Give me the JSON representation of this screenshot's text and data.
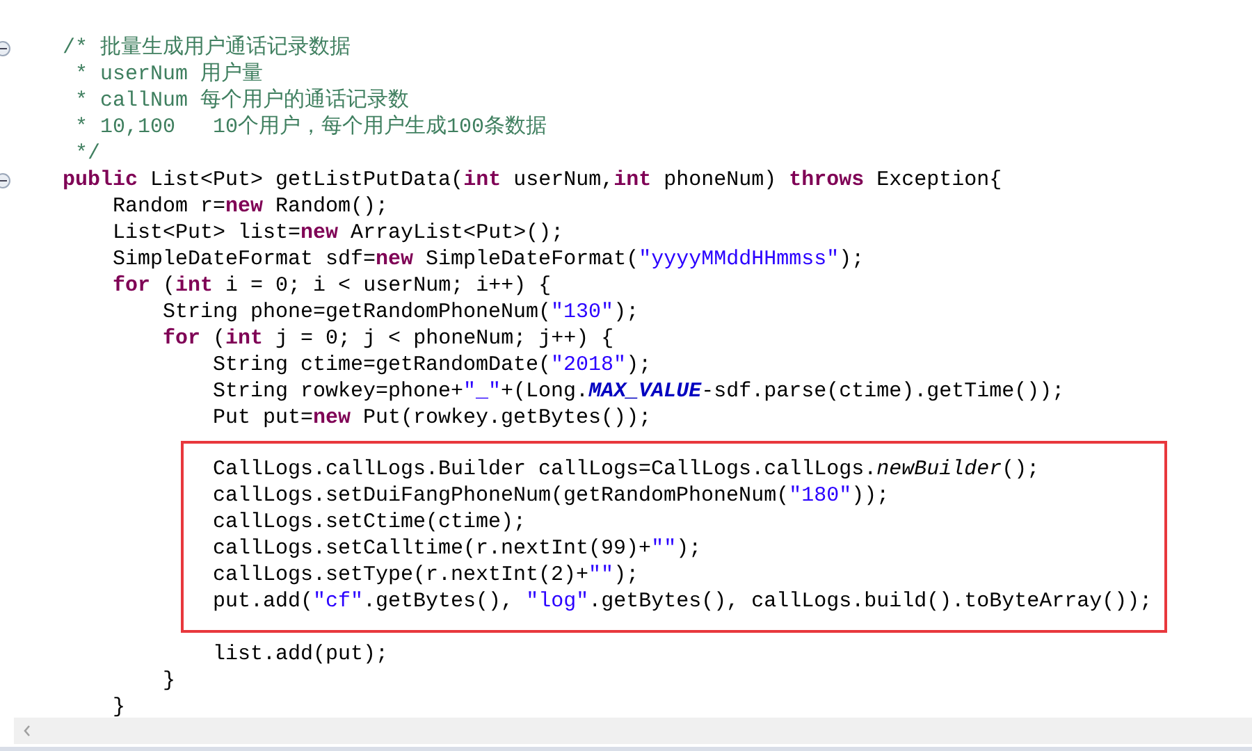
{
  "editor": {
    "lines": [
      {
        "expanded": true,
        "tokens": [
          {
            "kind": "comment",
            "text": "/* 批量生成用户通话记录数据"
          }
        ]
      },
      {
        "tokens": [
          {
            "kind": "comment",
            "text": " * userNum 用户量"
          }
        ]
      },
      {
        "tokens": [
          {
            "kind": "comment",
            "text": " * callNum 每个用户的通话记录数"
          }
        ]
      },
      {
        "tokens": [
          {
            "kind": "comment",
            "text": " * 10,100   10个用户，每个用户生成100条数据"
          }
        ]
      },
      {
        "tokens": [
          {
            "kind": "comment",
            "text": " */"
          }
        ]
      },
      {
        "expanded": true,
        "tokens": [
          {
            "kind": "keyword",
            "text": "public"
          },
          {
            "kind": "plain",
            "text": " List<Put> getListPutData("
          },
          {
            "kind": "keyword",
            "text": "int"
          },
          {
            "kind": "plain",
            "text": " userNum,"
          },
          {
            "kind": "keyword",
            "text": "int"
          },
          {
            "kind": "plain",
            "text": " phoneNum) "
          },
          {
            "kind": "keyword",
            "text": "throws"
          },
          {
            "kind": "plain",
            "text": " Exception{"
          }
        ],
        "children": [
          {
            "tokens": [
              {
                "kind": "plain",
                "text": "Random r="
              },
              {
                "kind": "keyword",
                "text": "new"
              },
              {
                "kind": "plain",
                "text": " Random();"
              }
            ]
          },
          {
            "tokens": [
              {
                "kind": "plain",
                "text": "List<Put> list="
              },
              {
                "kind": "keyword",
                "text": "new"
              },
              {
                "kind": "plain",
                "text": " ArrayList<Put>();"
              }
            ]
          },
          {
            "tokens": [
              {
                "kind": "plain",
                "text": "SimpleDateFormat sdf="
              },
              {
                "kind": "keyword",
                "text": "new"
              },
              {
                "kind": "plain",
                "text": " SimpleDateFormat("
              },
              {
                "kind": "string",
                "text": "\"yyyyMMddHHmmss\""
              },
              {
                "kind": "plain",
                "text": ");"
              }
            ]
          },
          {
            "tokens": [
              {
                "kind": "keyword",
                "text": "for"
              },
              {
                "kind": "plain",
                "text": " ("
              },
              {
                "kind": "keyword",
                "text": "int"
              },
              {
                "kind": "plain",
                "text": " i = 0; i < userNum; i++) {"
              }
            ],
            "end": "}",
            "children": [
              {
                "tokens": [
                  {
                    "kind": "plain",
                    "text": "String phone=getRandomPhoneNum("
                  },
                  {
                    "kind": "string",
                    "text": "\"130\""
                  },
                  {
                    "kind": "plain",
                    "text": ");"
                  }
                ]
              },
              {
                "tokens": [
                  {
                    "kind": "keyword",
                    "text": "for"
                  },
                  {
                    "kind": "plain",
                    "text": " ("
                  },
                  {
                    "kind": "keyword",
                    "text": "int"
                  },
                  {
                    "kind": "plain",
                    "text": " j = 0; j < phoneNum; j++) {"
                  }
                ],
                "end": "}",
                "children": [
                  {
                    "kind": "line",
                    "tokens": [
                      {
                        "kind": "plain",
                        "text": "String ctime=getRandomDate("
                      },
                      {
                        "kind": "string",
                        "text": "\"2018\""
                      },
                      {
                        "kind": "plain",
                        "text": ");"
                      }
                    ]
                  },
                  {
                    "kind": "line",
                    "tokens": [
                      {
                        "kind": "plain",
                        "text": "String rowkey=phone+"
                      },
                      {
                        "kind": "string",
                        "text": "\"_\""
                      },
                      {
                        "kind": "plain",
                        "text": "+(Long."
                      },
                      {
                        "kind": "constant",
                        "text": "MAX_VALUE"
                      },
                      {
                        "kind": "plain",
                        "text": "-sdf.parse(ctime).getTime());"
                      }
                    ]
                  },
                  {
                    "kind": "line",
                    "tokens": [
                      {
                        "kind": "plain",
                        "text": "Put put="
                      },
                      {
                        "kind": "keyword",
                        "text": "new"
                      },
                      {
                        "kind": "plain",
                        "text": " Put(rowkey.getBytes());"
                      }
                    ]
                  },
                  {
                    "kind": "highlight",
                    "lines": [
                      {
                        "tokens": [
                          {
                            "kind": "plain",
                            "text": "CallLogs.callLogs.Builder callLogs=CallLogs.callLogs."
                          },
                          {
                            "kind": "static",
                            "text": "newBuilder"
                          },
                          {
                            "kind": "plain",
                            "text": "();"
                          }
                        ]
                      },
                      {
                        "tokens": [
                          {
                            "kind": "plain",
                            "text": "callLogs.setDuiFangPhoneNum(getRandomPhoneNum("
                          },
                          {
                            "kind": "string",
                            "text": "\"180\""
                          },
                          {
                            "kind": "plain",
                            "text": "));"
                          }
                        ]
                      },
                      {
                        "tokens": [
                          {
                            "kind": "plain",
                            "text": "callLogs.setCtime(ctime);"
                          }
                        ]
                      },
                      {
                        "tokens": [
                          {
                            "kind": "plain",
                            "text": "callLogs.setCalltime(r.nextInt(99)+"
                          },
                          {
                            "kind": "string",
                            "text": "\"\""
                          },
                          {
                            "kind": "plain",
                            "text": ");"
                          }
                        ]
                      },
                      {
                        "tokens": [
                          {
                            "kind": "plain",
                            "text": "callLogs.setType(r.nextInt(2)+"
                          },
                          {
                            "kind": "string",
                            "text": "\"\""
                          },
                          {
                            "kind": "plain",
                            "text": ");"
                          }
                        ]
                      },
                      {
                        "tokens": [
                          {
                            "kind": "plain",
                            "text": "put.add("
                          },
                          {
                            "kind": "string",
                            "text": "\"cf\""
                          },
                          {
                            "kind": "plain",
                            "text": ".getBytes(), "
                          },
                          {
                            "kind": "string",
                            "text": "\"log\""
                          },
                          {
                            "kind": "plain",
                            "text": ".getBytes(), callLogs.build().toByteArray());"
                          }
                        ]
                      }
                    ]
                  },
                  {
                    "kind": "line",
                    "tokens": [
                      {
                        "kind": "plain",
                        "text": "list.add(put);"
                      }
                    ]
                  }
                ]
              }
            ]
          }
        ]
      }
    ]
  }
}
